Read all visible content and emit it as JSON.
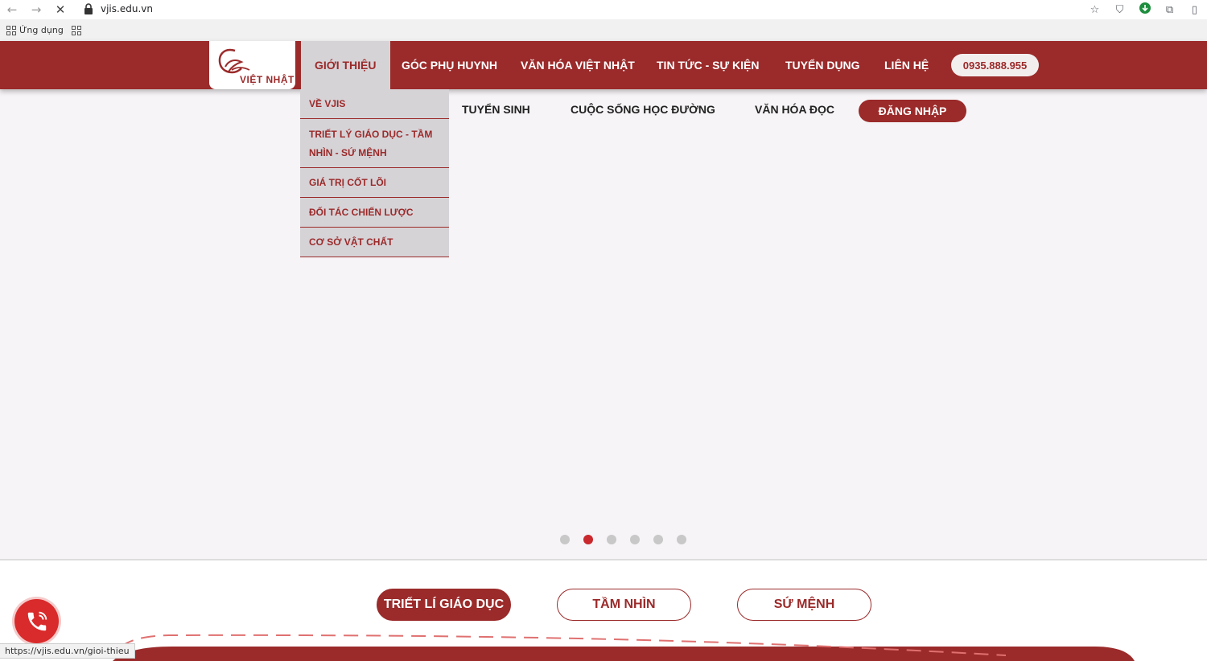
{
  "browser": {
    "url": "vjis.edu.vn",
    "bookmarks_label": "Ứng dụng",
    "status_url": "https://vjis.edu.vn/gioi-thieu"
  },
  "logo": {
    "text": "VIỆT NHẬT"
  },
  "menu": {
    "items": [
      "GIỚI THIỆU",
      "GÓC PHỤ HUYNH",
      "VĂN HÓA VIỆT NHẬT",
      "TIN TỨC - SỰ KIỆN",
      "TUYỂN DỤNG",
      "LIÊN HỆ"
    ],
    "phone": "0935.888.955"
  },
  "dropdown": {
    "items": [
      "VỀ VJIS",
      "TRIẾT LÝ GIÁO DỤC - TẦM NHÌN - SỨ MỆNH",
      "GIÁ TRỊ CỐT LÕI",
      "ĐỐI TÁC CHIẾN LƯỢC",
      "CƠ SỞ VẬT CHẤT"
    ]
  },
  "submenu": {
    "items": [
      "TUYỂN SINH",
      "CUỘC SỐNG HỌC ĐƯỜNG",
      "VĂN HÓA ĐỌC"
    ],
    "login": "ĐĂNG NHẬP"
  },
  "slider": {
    "count": 6,
    "active_index": 1
  },
  "tabs": {
    "items": [
      "TRIẾT LÍ GIÁO DỤC",
      "TẦM NHÌN",
      "SỨ MỆNH"
    ],
    "active_index": 0
  },
  "colors": {
    "brand": "#9b2a2a",
    "dot_active": "#c9282d",
    "call_button": "#d92b2b"
  },
  "icons": {
    "back": "arrow-left-icon",
    "forward": "arrow-right-icon",
    "stop": "close-icon",
    "lock": "lock-icon",
    "star": "star-icon",
    "shield": "shield-icon",
    "download": "download-icon",
    "extensions": "puzzle-icon",
    "sidebar": "sidebar-icon",
    "apps": "grid-icon",
    "phone": "phone-icon"
  }
}
